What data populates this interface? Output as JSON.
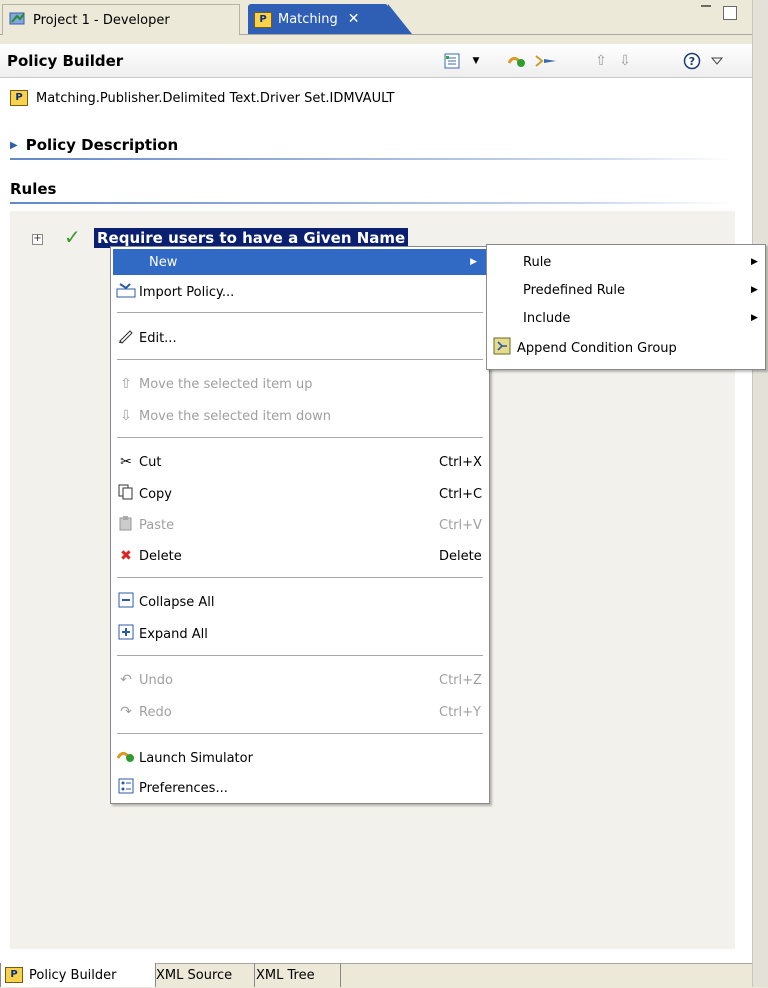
{
  "tabs": {
    "project_label": "Project 1 - Developer",
    "matching_label": "Matching",
    "close_glyph": "✕"
  },
  "window_controls": {
    "minimize": "▭"
  },
  "header": {
    "title": "Policy Builder",
    "toolbar_icons": [
      "policy-sheet-icon",
      "dropdown-icon",
      "simulator-icon",
      "trace-icon",
      "move-up-icon",
      "move-down-icon",
      "help-icon",
      "view-menu-icon"
    ]
  },
  "policy_path": "Matching.Publisher.Delimited Text.Driver Set.IDMVAULT",
  "policy_description_label": "Policy Description",
  "rules_label": "Rules",
  "rule_item_label": "Require users to have a Given Name",
  "context_menu": {
    "new": "New",
    "import_policy": "Import Policy...",
    "edit": "Edit...",
    "move_up": "Move the selected item up",
    "move_down": "Move the selected item down",
    "cut": "Cut",
    "cut_sc": "Ctrl+X",
    "copy": "Copy",
    "copy_sc": "Ctrl+C",
    "paste": "Paste",
    "paste_sc": "Ctrl+V",
    "delete": "Delete",
    "delete_sc": "Delete",
    "collapse_all": "Collapse All",
    "expand_all": "Expand All",
    "undo": "Undo",
    "undo_sc": "Ctrl+Z",
    "redo": "Redo",
    "redo_sc": "Ctrl+Y",
    "launch_simulator": "Launch Simulator",
    "preferences": "Preferences..."
  },
  "submenu": {
    "rule": "Rule",
    "predefined_rule": "Predefined Rule",
    "include": "Include",
    "append_condition_group": "Append Condition Group"
  },
  "bottom_tabs": {
    "policy_builder": "Policy Builder",
    "xml_source": "XML Source",
    "xml_tree": "XML Tree"
  },
  "colors": {
    "selection": "#316ac5",
    "active_tab": "#2f5fb5",
    "rule_highlight": "#0a1f6f"
  }
}
